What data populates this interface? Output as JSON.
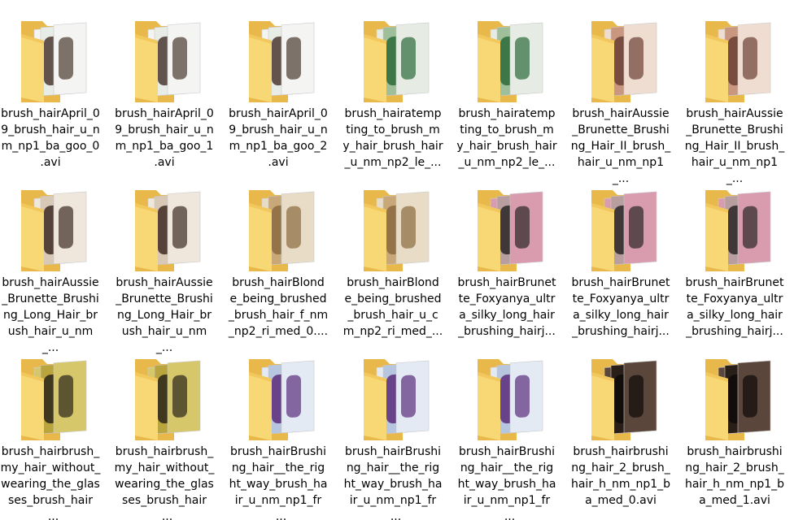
{
  "files": [
    {
      "label": "brush_hairApril_0 9_brush_hair_u_n m_np1_ba_goo_0 .avi",
      "thumb": "light"
    },
    {
      "label": "brush_hairApril_0 9_brush_hair_u_n m_np1_ba_goo_1 .avi",
      "thumb": "light"
    },
    {
      "label": "brush_hairApril_0 9_brush_hair_u_n m_np1_ba_goo_2 .avi",
      "thumb": "light"
    },
    {
      "label": "brush_hairatemp ting_to_brush_m y_hair_brush_hair _u_nm_np2_le_...",
      "thumb": "green"
    },
    {
      "label": "brush_hairatemp ting_to_brush_m y_hair_brush_hair _u_nm_np2_le_...",
      "thumb": "green"
    },
    {
      "label": "brush_hairAussie _Brunette_Brushi ng_Hair_II_brush_ hair_u_nm_np1_...",
      "thumb": "skin"
    },
    {
      "label": "brush_hairAussie _Brunette_Brushi ng_Hair_II_brush_ hair_u_nm_np1_...",
      "thumb": "skin"
    },
    {
      "label": "brush_hairAussie _Brunette_Brushi ng_Long_Hair_br ush_hair_u_nm_...",
      "thumb": "room"
    },
    {
      "label": "brush_hairAussie _Brunette_Brushi ng_Long_Hair_br ush_hair_u_nm_...",
      "thumb": "room"
    },
    {
      "label": "brush_hairBlond e_being_brushed _brush_hair_f_nm _np2_ri_med_0....",
      "thumb": "blonde"
    },
    {
      "label": "brush_hairBlond e_being_brushed _brush_hair_u_c m_np2_ri_med_...",
      "thumb": "blonde"
    },
    {
      "label": "brush_hairBrunet te_Foxyanya_ultr a_silky_long_hair _brushing_hairj...",
      "thumb": "pink"
    },
    {
      "label": "brush_hairBrunet te_Foxyanya_ultr a_silky_long_hair _brushing_hairj...",
      "thumb": "pink"
    },
    {
      "label": "brush_hairBrunet te_Foxyanya_ultr a_silky_long_hair _brushing_hairj...",
      "thumb": "pink"
    },
    {
      "label": "brush_hairbrush_ my_hair_without_ wearing_the_glas ses_brush_hair_...",
      "thumb": "yellow"
    },
    {
      "label": "brush_hairbrush_ my_hair_without_ wearing_the_glas ses_brush_hair_...",
      "thumb": "yellow"
    },
    {
      "label": "brush_hairBrushi ng_hair__the_rig ht_way_brush_ha ir_u_nm_np1_fr_...",
      "thumb": "purple"
    },
    {
      "label": "brush_hairBrushi ng_hair__the_rig ht_way_brush_ha ir_u_nm_np1_fr_...",
      "thumb": "purple"
    },
    {
      "label": "brush_hairBrushi ng_hair__the_rig ht_way_brush_ha ir_u_nm_np1_fr_...",
      "thumb": "purple"
    },
    {
      "label": "brush_hairbrushi ng_hair_2_brush_ hair_h_nm_np1_b a_med_0.avi",
      "thumb": "dark"
    },
    {
      "label": "brush_hairbrushi ng_hair_2_brush_ hair_h_nm_np1_b a_med_1.avi",
      "thumb": "dark"
    }
  ],
  "thumb_palettes": {
    "light": {
      "a": "#e8ece6",
      "b": "#4a3a30",
      "c": "#f4f4f2"
    },
    "green": {
      "a": "#9fbf9a",
      "b": "#2b6a3a",
      "c": "#e6ece4"
    },
    "skin": {
      "a": "#c99680",
      "b": "#6a4032",
      "c": "#f0ddd2"
    },
    "room": {
      "a": "#d8c8b6",
      "b": "#3e2c24",
      "c": "#efe6dc"
    },
    "blonde": {
      "a": "#c8a878",
      "b": "#8a6a3e",
      "c": "#e8dcc6"
    },
    "pink": {
      "a": "#b89e9e",
      "b": "#2a2626",
      "c": "#d99cae"
    },
    "yellow": {
      "a": "#b9a43e",
      "b": "#2a241a",
      "c": "#d6c86a"
    },
    "purple": {
      "a": "#b6c6de",
      "b": "#5a2c7a",
      "c": "#e4eaf4"
    },
    "dark": {
      "a": "#2a1e18",
      "b": "#0e0a08",
      "c": "#5a463a"
    }
  },
  "folder_colors": {
    "back": "#e8b84a",
    "front": "#f8d775",
    "shade": "#f2c85c"
  }
}
